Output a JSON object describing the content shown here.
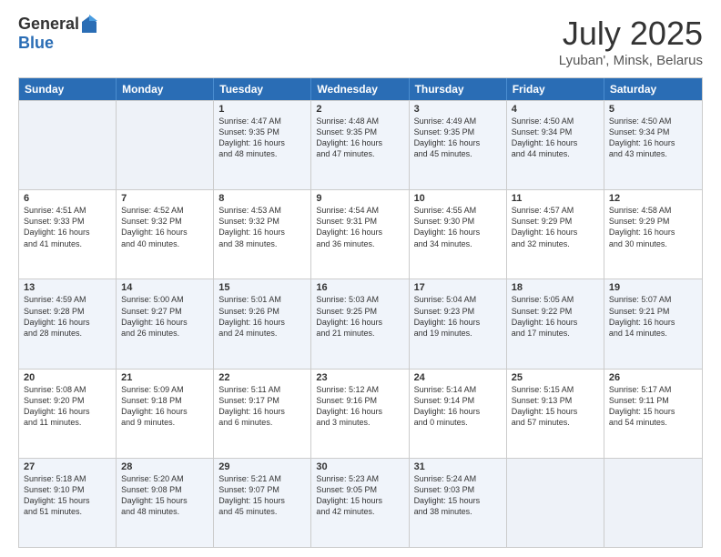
{
  "header": {
    "logo_general": "General",
    "logo_blue": "Blue",
    "month": "July 2025",
    "location": "Lyuban', Minsk, Belarus"
  },
  "days_of_week": [
    "Sunday",
    "Monday",
    "Tuesday",
    "Wednesday",
    "Thursday",
    "Friday",
    "Saturday"
  ],
  "rows": [
    [
      {
        "day": "",
        "empty": true
      },
      {
        "day": "",
        "empty": true
      },
      {
        "day": "1",
        "line1": "Sunrise: 4:47 AM",
        "line2": "Sunset: 9:35 PM",
        "line3": "Daylight: 16 hours",
        "line4": "and 48 minutes."
      },
      {
        "day": "2",
        "line1": "Sunrise: 4:48 AM",
        "line2": "Sunset: 9:35 PM",
        "line3": "Daylight: 16 hours",
        "line4": "and 47 minutes."
      },
      {
        "day": "3",
        "line1": "Sunrise: 4:49 AM",
        "line2": "Sunset: 9:35 PM",
        "line3": "Daylight: 16 hours",
        "line4": "and 45 minutes."
      },
      {
        "day": "4",
        "line1": "Sunrise: 4:50 AM",
        "line2": "Sunset: 9:34 PM",
        "line3": "Daylight: 16 hours",
        "line4": "and 44 minutes."
      },
      {
        "day": "5",
        "line1": "Sunrise: 4:50 AM",
        "line2": "Sunset: 9:34 PM",
        "line3": "Daylight: 16 hours",
        "line4": "and 43 minutes."
      }
    ],
    [
      {
        "day": "6",
        "line1": "Sunrise: 4:51 AM",
        "line2": "Sunset: 9:33 PM",
        "line3": "Daylight: 16 hours",
        "line4": "and 41 minutes."
      },
      {
        "day": "7",
        "line1": "Sunrise: 4:52 AM",
        "line2": "Sunset: 9:32 PM",
        "line3": "Daylight: 16 hours",
        "line4": "and 40 minutes."
      },
      {
        "day": "8",
        "line1": "Sunrise: 4:53 AM",
        "line2": "Sunset: 9:32 PM",
        "line3": "Daylight: 16 hours",
        "line4": "and 38 minutes."
      },
      {
        "day": "9",
        "line1": "Sunrise: 4:54 AM",
        "line2": "Sunset: 9:31 PM",
        "line3": "Daylight: 16 hours",
        "line4": "and 36 minutes."
      },
      {
        "day": "10",
        "line1": "Sunrise: 4:55 AM",
        "line2": "Sunset: 9:30 PM",
        "line3": "Daylight: 16 hours",
        "line4": "and 34 minutes."
      },
      {
        "day": "11",
        "line1": "Sunrise: 4:57 AM",
        "line2": "Sunset: 9:29 PM",
        "line3": "Daylight: 16 hours",
        "line4": "and 32 minutes."
      },
      {
        "day": "12",
        "line1": "Sunrise: 4:58 AM",
        "line2": "Sunset: 9:29 PM",
        "line3": "Daylight: 16 hours",
        "line4": "and 30 minutes."
      }
    ],
    [
      {
        "day": "13",
        "line1": "Sunrise: 4:59 AM",
        "line2": "Sunset: 9:28 PM",
        "line3": "Daylight: 16 hours",
        "line4": "and 28 minutes."
      },
      {
        "day": "14",
        "line1": "Sunrise: 5:00 AM",
        "line2": "Sunset: 9:27 PM",
        "line3": "Daylight: 16 hours",
        "line4": "and 26 minutes."
      },
      {
        "day": "15",
        "line1": "Sunrise: 5:01 AM",
        "line2": "Sunset: 9:26 PM",
        "line3": "Daylight: 16 hours",
        "line4": "and 24 minutes."
      },
      {
        "day": "16",
        "line1": "Sunrise: 5:03 AM",
        "line2": "Sunset: 9:25 PM",
        "line3": "Daylight: 16 hours",
        "line4": "and 21 minutes."
      },
      {
        "day": "17",
        "line1": "Sunrise: 5:04 AM",
        "line2": "Sunset: 9:23 PM",
        "line3": "Daylight: 16 hours",
        "line4": "and 19 minutes."
      },
      {
        "day": "18",
        "line1": "Sunrise: 5:05 AM",
        "line2": "Sunset: 9:22 PM",
        "line3": "Daylight: 16 hours",
        "line4": "and 17 minutes."
      },
      {
        "day": "19",
        "line1": "Sunrise: 5:07 AM",
        "line2": "Sunset: 9:21 PM",
        "line3": "Daylight: 16 hours",
        "line4": "and 14 minutes."
      }
    ],
    [
      {
        "day": "20",
        "line1": "Sunrise: 5:08 AM",
        "line2": "Sunset: 9:20 PM",
        "line3": "Daylight: 16 hours",
        "line4": "and 11 minutes."
      },
      {
        "day": "21",
        "line1": "Sunrise: 5:09 AM",
        "line2": "Sunset: 9:18 PM",
        "line3": "Daylight: 16 hours",
        "line4": "and 9 minutes."
      },
      {
        "day": "22",
        "line1": "Sunrise: 5:11 AM",
        "line2": "Sunset: 9:17 PM",
        "line3": "Daylight: 16 hours",
        "line4": "and 6 minutes."
      },
      {
        "day": "23",
        "line1": "Sunrise: 5:12 AM",
        "line2": "Sunset: 9:16 PM",
        "line3": "Daylight: 16 hours",
        "line4": "and 3 minutes."
      },
      {
        "day": "24",
        "line1": "Sunrise: 5:14 AM",
        "line2": "Sunset: 9:14 PM",
        "line3": "Daylight: 16 hours",
        "line4": "and 0 minutes."
      },
      {
        "day": "25",
        "line1": "Sunrise: 5:15 AM",
        "line2": "Sunset: 9:13 PM",
        "line3": "Daylight: 15 hours",
        "line4": "and 57 minutes."
      },
      {
        "day": "26",
        "line1": "Sunrise: 5:17 AM",
        "line2": "Sunset: 9:11 PM",
        "line3": "Daylight: 15 hours",
        "line4": "and 54 minutes."
      }
    ],
    [
      {
        "day": "27",
        "line1": "Sunrise: 5:18 AM",
        "line2": "Sunset: 9:10 PM",
        "line3": "Daylight: 15 hours",
        "line4": "and 51 minutes."
      },
      {
        "day": "28",
        "line1": "Sunrise: 5:20 AM",
        "line2": "Sunset: 9:08 PM",
        "line3": "Daylight: 15 hours",
        "line4": "and 48 minutes."
      },
      {
        "day": "29",
        "line1": "Sunrise: 5:21 AM",
        "line2": "Sunset: 9:07 PM",
        "line3": "Daylight: 15 hours",
        "line4": "and 45 minutes."
      },
      {
        "day": "30",
        "line1": "Sunrise: 5:23 AM",
        "line2": "Sunset: 9:05 PM",
        "line3": "Daylight: 15 hours",
        "line4": "and 42 minutes."
      },
      {
        "day": "31",
        "line1": "Sunrise: 5:24 AM",
        "line2": "Sunset: 9:03 PM",
        "line3": "Daylight: 15 hours",
        "line4": "and 38 minutes."
      },
      {
        "day": "",
        "empty": true
      },
      {
        "day": "",
        "empty": true
      }
    ]
  ],
  "alt_rows": [
    0,
    2,
    4
  ]
}
